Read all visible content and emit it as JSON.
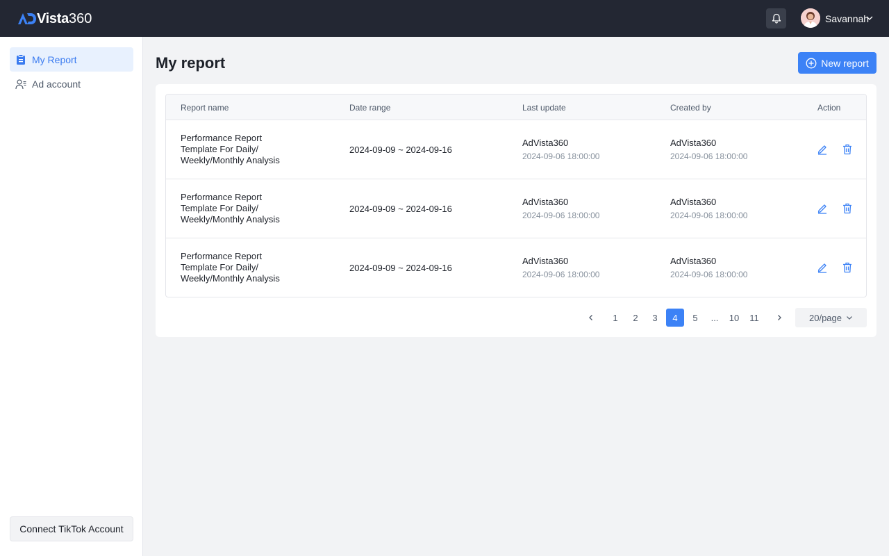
{
  "header": {
    "brand_main": "Vista",
    "brand_num": "360",
    "user_name": "Savannah"
  },
  "sidebar": {
    "items": [
      {
        "label": "My Report",
        "icon": "clipboard-icon",
        "active": true
      },
      {
        "label": "Ad account",
        "icon": "user-list-icon",
        "active": false
      }
    ],
    "connect_label": "Connect TikTok Account"
  },
  "main": {
    "title": "My report",
    "new_button": "New report",
    "columns": [
      "Report name",
      "Date range",
      "Last update",
      "Created by",
      "Action"
    ],
    "rows": [
      {
        "name_lines": [
          "Performance Report",
          "Template For Daily/",
          "Weekly/Monthly Analysis"
        ],
        "date_range": "2024-09-09 ~ 2024-09-16",
        "updated_by": "AdVista360",
        "updated_at": "2024-09-06 18:00:00",
        "created_by": "AdVista360",
        "created_at": "2024-09-06 18:00:00"
      },
      {
        "name_lines": [
          "Performance Report",
          "Template For Daily/",
          "Weekly/Monthly Analysis"
        ],
        "date_range": "2024-09-09 ~ 2024-09-16",
        "updated_by": "AdVista360",
        "updated_at": "2024-09-06 18:00:00",
        "created_by": "AdVista360",
        "created_at": "2024-09-06 18:00:00"
      },
      {
        "name_lines": [
          "Performance Report",
          "Template For Daily/",
          "Weekly/Monthly Analysis"
        ],
        "date_range": "2024-09-09 ~ 2024-09-16",
        "updated_by": "AdVista360",
        "updated_at": "2024-09-06 18:00:00",
        "created_by": "AdVista360",
        "created_at": "2024-09-06 18:00:00"
      }
    ],
    "pagination": {
      "pages": [
        "1",
        "2",
        "3",
        "4",
        "5",
        "...",
        "10",
        "11"
      ],
      "current": "4",
      "per_page": "20/page"
    }
  },
  "colors": {
    "accent": "#3c82f6",
    "header_bg": "#232733"
  }
}
